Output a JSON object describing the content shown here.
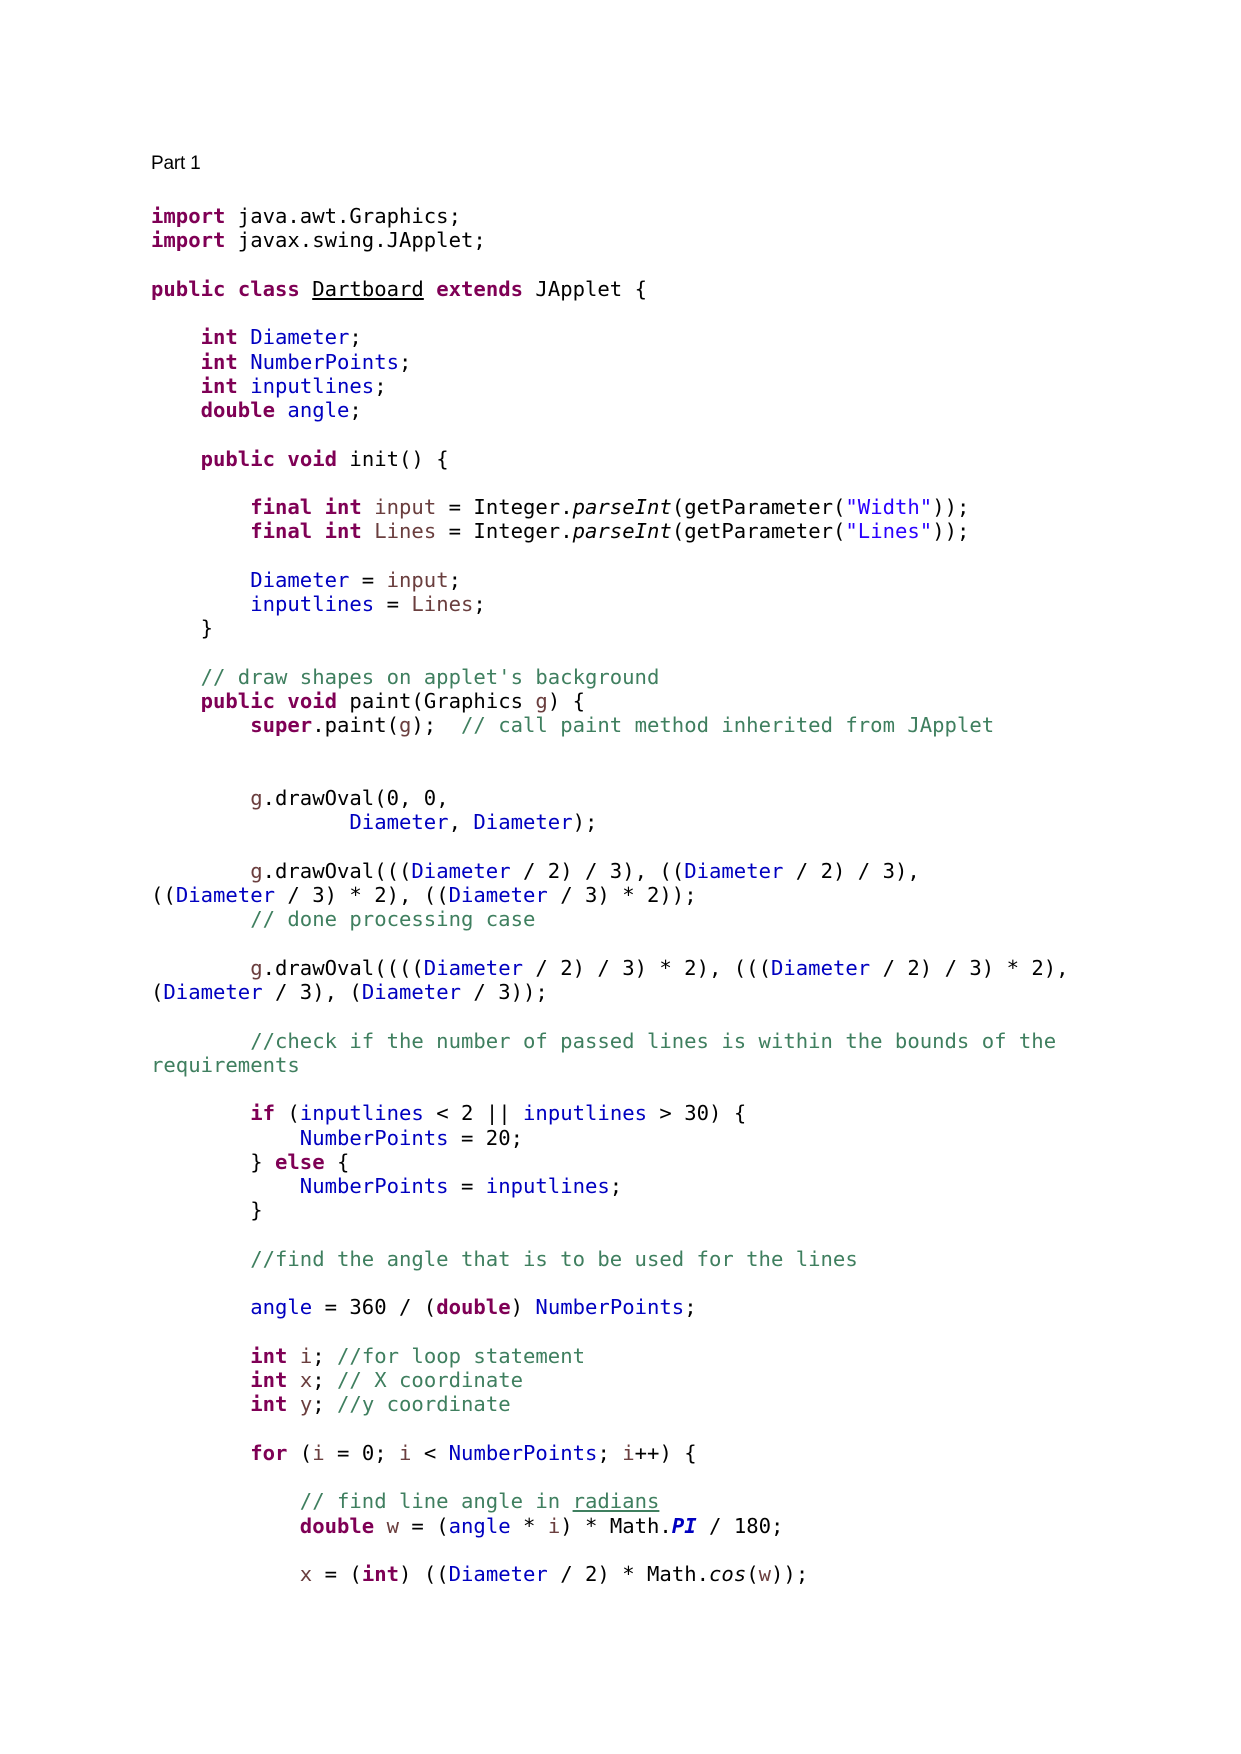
{
  "document": {
    "heading": "Part 1",
    "language": "java",
    "lines": [
      [
        [
          "kw",
          "import"
        ],
        [
          "plain",
          " java.awt.Graphics;"
        ]
      ],
      [
        [
          "kw",
          "import"
        ],
        [
          "plain",
          " javax.swing.JApplet;"
        ]
      ],
      [],
      [
        [
          "kw",
          "public"
        ],
        [
          "plain",
          " "
        ],
        [
          "kw",
          "class"
        ],
        [
          "plain",
          " "
        ],
        [
          "ul",
          "Dartboard"
        ],
        [
          "plain",
          " "
        ],
        [
          "kw",
          "extends"
        ],
        [
          "plain",
          " JApplet {"
        ]
      ],
      [],
      [
        [
          "plain",
          "    "
        ],
        [
          "kw",
          "int"
        ],
        [
          "plain",
          " "
        ],
        [
          "fld",
          "Diameter"
        ],
        [
          "plain",
          ";"
        ]
      ],
      [
        [
          "plain",
          "    "
        ],
        [
          "kw",
          "int"
        ],
        [
          "plain",
          " "
        ],
        [
          "fld",
          "NumberPoints"
        ],
        [
          "plain",
          ";"
        ]
      ],
      [
        [
          "plain",
          "    "
        ],
        [
          "kw",
          "int"
        ],
        [
          "plain",
          " "
        ],
        [
          "fld",
          "inputlines"
        ],
        [
          "plain",
          ";"
        ]
      ],
      [
        [
          "plain",
          "    "
        ],
        [
          "kw",
          "double"
        ],
        [
          "plain",
          " "
        ],
        [
          "fld",
          "angle"
        ],
        [
          "plain",
          ";"
        ]
      ],
      [],
      [
        [
          "plain",
          "    "
        ],
        [
          "kw",
          "public"
        ],
        [
          "plain",
          " "
        ],
        [
          "kw",
          "void"
        ],
        [
          "plain",
          " init() {"
        ]
      ],
      [],
      [
        [
          "plain",
          "        "
        ],
        [
          "kw",
          "final"
        ],
        [
          "plain",
          " "
        ],
        [
          "kw",
          "int"
        ],
        [
          "plain",
          " "
        ],
        [
          "loc",
          "input"
        ],
        [
          "plain",
          " = Integer."
        ],
        [
          "it",
          "parseInt"
        ],
        [
          "plain",
          "(getParameter("
        ],
        [
          "str",
          "\"Width\""
        ],
        [
          "plain",
          "));"
        ]
      ],
      [
        [
          "plain",
          "        "
        ],
        [
          "kw",
          "final"
        ],
        [
          "plain",
          " "
        ],
        [
          "kw",
          "int"
        ],
        [
          "plain",
          " "
        ],
        [
          "loc",
          "Lines"
        ],
        [
          "plain",
          " = Integer."
        ],
        [
          "it",
          "parseInt"
        ],
        [
          "plain",
          "(getParameter("
        ],
        [
          "str",
          "\"Lines\""
        ],
        [
          "plain",
          "));"
        ]
      ],
      [],
      [
        [
          "plain",
          "        "
        ],
        [
          "fld",
          "Diameter"
        ],
        [
          "plain",
          " = "
        ],
        [
          "loc",
          "input"
        ],
        [
          "plain",
          ";"
        ]
      ],
      [
        [
          "plain",
          "        "
        ],
        [
          "fld",
          "inputlines"
        ],
        [
          "plain",
          " = "
        ],
        [
          "loc",
          "Lines"
        ],
        [
          "plain",
          ";"
        ]
      ],
      [
        [
          "plain",
          "    }"
        ]
      ],
      [],
      [
        [
          "plain",
          "    "
        ],
        [
          "cmt",
          "// draw shapes on applet's background"
        ]
      ],
      [
        [
          "plain",
          "    "
        ],
        [
          "kw",
          "public"
        ],
        [
          "plain",
          " "
        ],
        [
          "kw",
          "void"
        ],
        [
          "plain",
          " paint(Graphics "
        ],
        [
          "loc",
          "g"
        ],
        [
          "plain",
          ") {"
        ]
      ],
      [
        [
          "plain",
          "        "
        ],
        [
          "kw",
          "super"
        ],
        [
          "plain",
          ".paint("
        ],
        [
          "loc",
          "g"
        ],
        [
          "plain",
          ");  "
        ],
        [
          "cmt",
          "// call paint method inherited from JApplet"
        ]
      ],
      [],
      [],
      [
        [
          "plain",
          "        "
        ],
        [
          "loc",
          "g"
        ],
        [
          "plain",
          ".drawOval(0, 0,"
        ]
      ],
      [
        [
          "plain",
          "                "
        ],
        [
          "fld",
          "Diameter"
        ],
        [
          "plain",
          ", "
        ],
        [
          "fld",
          "Diameter"
        ],
        [
          "plain",
          ");"
        ]
      ],
      [],
      [
        [
          "plain",
          "        "
        ],
        [
          "loc",
          "g"
        ],
        [
          "plain",
          ".drawOval((("
        ],
        [
          "fld",
          "Diameter"
        ],
        [
          "plain",
          " / 2) / 3), (("
        ],
        [
          "fld",
          "Diameter"
        ],
        [
          "plain",
          " / 2) / 3),"
        ]
      ],
      [
        [
          "plain",
          "(("
        ],
        [
          "fld",
          "Diameter"
        ],
        [
          "plain",
          " / 3) * 2), (("
        ],
        [
          "fld",
          "Diameter"
        ],
        [
          "plain",
          " / 3) * 2));"
        ]
      ],
      [
        [
          "plain",
          "        "
        ],
        [
          "cmt",
          "// done processing case"
        ]
      ],
      [],
      [
        [
          "plain",
          "        "
        ],
        [
          "loc",
          "g"
        ],
        [
          "plain",
          ".drawOval(((("
        ],
        [
          "fld",
          "Diameter"
        ],
        [
          "plain",
          " / 2) / 3) * 2), ((("
        ],
        [
          "fld",
          "Diameter"
        ],
        [
          "plain",
          " / 2) / 3) * 2),"
        ]
      ],
      [
        [
          "plain",
          "("
        ],
        [
          "fld",
          "Diameter"
        ],
        [
          "plain",
          " / 3), ("
        ],
        [
          "fld",
          "Diameter"
        ],
        [
          "plain",
          " / 3));"
        ]
      ],
      [],
      [
        [
          "plain",
          "        "
        ],
        [
          "cmt",
          "//check if the number of passed lines is within the bounds of the"
        ]
      ],
      [
        [
          "cmt",
          "requirements"
        ]
      ],
      [],
      [
        [
          "plain",
          "        "
        ],
        [
          "kw",
          "if"
        ],
        [
          "plain",
          " ("
        ],
        [
          "fld",
          "inputlines"
        ],
        [
          "plain",
          " < 2 || "
        ],
        [
          "fld",
          "inputlines"
        ],
        [
          "plain",
          " > 30) {"
        ]
      ],
      [
        [
          "plain",
          "            "
        ],
        [
          "fld",
          "NumberPoints"
        ],
        [
          "plain",
          " = 20;"
        ]
      ],
      [
        [
          "plain",
          "        } "
        ],
        [
          "kw",
          "else"
        ],
        [
          "plain",
          " {"
        ]
      ],
      [
        [
          "plain",
          "            "
        ],
        [
          "fld",
          "NumberPoints"
        ],
        [
          "plain",
          " = "
        ],
        [
          "fld",
          "inputlines"
        ],
        [
          "plain",
          ";"
        ]
      ],
      [
        [
          "plain",
          "        }"
        ]
      ],
      [],
      [
        [
          "plain",
          "        "
        ],
        [
          "cmt",
          "//find the angle that is to be used for the lines"
        ]
      ],
      [],
      [
        [
          "plain",
          "        "
        ],
        [
          "fld",
          "angle"
        ],
        [
          "plain",
          " = 360 / ("
        ],
        [
          "kw",
          "double"
        ],
        [
          "plain",
          ") "
        ],
        [
          "fld",
          "NumberPoints"
        ],
        [
          "plain",
          ";"
        ]
      ],
      [],
      [
        [
          "plain",
          "        "
        ],
        [
          "kw",
          "int"
        ],
        [
          "plain",
          " "
        ],
        [
          "loc",
          "i"
        ],
        [
          "plain",
          "; "
        ],
        [
          "cmt",
          "//for loop statement"
        ]
      ],
      [
        [
          "plain",
          "        "
        ],
        [
          "kw",
          "int"
        ],
        [
          "plain",
          " "
        ],
        [
          "loc",
          "x"
        ],
        [
          "plain",
          "; "
        ],
        [
          "cmt",
          "// X coordinate"
        ]
      ],
      [
        [
          "plain",
          "        "
        ],
        [
          "kw",
          "int"
        ],
        [
          "plain",
          " "
        ],
        [
          "loc",
          "y"
        ],
        [
          "plain",
          "; "
        ],
        [
          "cmt",
          "//y coordinate"
        ]
      ],
      [],
      [
        [
          "plain",
          "        "
        ],
        [
          "kw",
          "for"
        ],
        [
          "plain",
          " ("
        ],
        [
          "loc",
          "i"
        ],
        [
          "plain",
          " = 0; "
        ],
        [
          "loc",
          "i"
        ],
        [
          "plain",
          " < "
        ],
        [
          "fld",
          "NumberPoints"
        ],
        [
          "plain",
          "; "
        ],
        [
          "loc",
          "i"
        ],
        [
          "plain",
          "++) {"
        ]
      ],
      [],
      [
        [
          "plain",
          "            "
        ],
        [
          "cmt",
          "// find line angle in "
        ],
        [
          "cmt ul",
          "radians"
        ]
      ],
      [
        [
          "plain",
          "            "
        ],
        [
          "kw",
          "double"
        ],
        [
          "plain",
          " "
        ],
        [
          "loc",
          "w"
        ],
        [
          "plain",
          " = ("
        ],
        [
          "fld",
          "angle"
        ],
        [
          "plain",
          " * "
        ],
        [
          "loc",
          "i"
        ],
        [
          "plain",
          ") * Math."
        ],
        [
          "sfld",
          "PI"
        ],
        [
          "plain",
          " / 180;"
        ]
      ],
      [],
      [
        [
          "plain",
          "            "
        ],
        [
          "loc",
          "x"
        ],
        [
          "plain",
          " = ("
        ],
        [
          "kw",
          "int"
        ],
        [
          "plain",
          ") (("
        ],
        [
          "fld",
          "Diameter"
        ],
        [
          "plain",
          " / 2) * Math."
        ],
        [
          "it",
          "cos"
        ],
        [
          "plain",
          "("
        ],
        [
          "loc",
          "w"
        ],
        [
          "plain",
          "));"
        ]
      ]
    ]
  },
  "token_colors": {
    "keyword": "#7f0055",
    "field": "#0000c0",
    "local_variable": "#6a3e3e",
    "comment": "#3f7f5f",
    "string": "#2a00ff"
  }
}
